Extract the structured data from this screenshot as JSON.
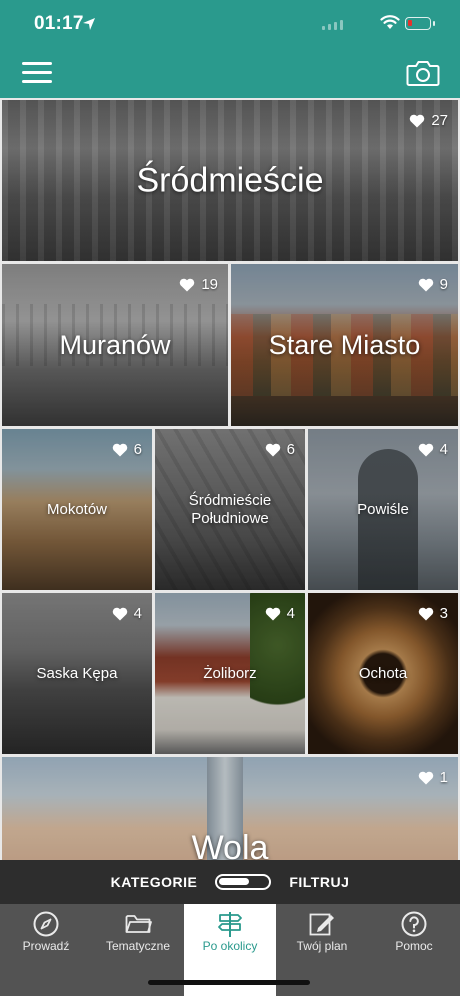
{
  "status_bar": {
    "time": "01:17"
  },
  "colors": {
    "primary": "#2a9a8d",
    "tab_bar": "#535353",
    "filter_bar": "#2d2d2d",
    "battery_low": "#e5322d"
  },
  "header": {
    "menu_icon": "hamburger-menu-icon",
    "camera_icon": "camera-icon"
  },
  "districts": [
    {
      "name": "Śródmieście",
      "likes": "27"
    },
    {
      "name": "Muranów",
      "likes": "19"
    },
    {
      "name": "Stare Miasto",
      "likes": "9"
    },
    {
      "name": "Mokotów",
      "likes": "6"
    },
    {
      "name": "Śródmieście Południowe",
      "likes": "6"
    },
    {
      "name": "Powiśle",
      "likes": "4"
    },
    {
      "name": "Saska Kępa",
      "likes": "4"
    },
    {
      "name": "Żoliborz",
      "likes": "4"
    },
    {
      "name": "Ochota",
      "likes": "3"
    },
    {
      "name": "Wola",
      "likes": "1"
    }
  ],
  "filter_bar": {
    "left_label": "KATEGORIE",
    "right_label": "FILTRUJ"
  },
  "tabs": [
    {
      "label": "Prowadź",
      "icon": "compass-icon"
    },
    {
      "label": "Tematyczne",
      "icon": "folder-icon"
    },
    {
      "label": "Po okolicy",
      "icon": "signpost-icon",
      "active": true
    },
    {
      "label": "Twój plan",
      "icon": "edit-plan-icon"
    },
    {
      "label": "Pomoc",
      "icon": "help-icon"
    }
  ]
}
